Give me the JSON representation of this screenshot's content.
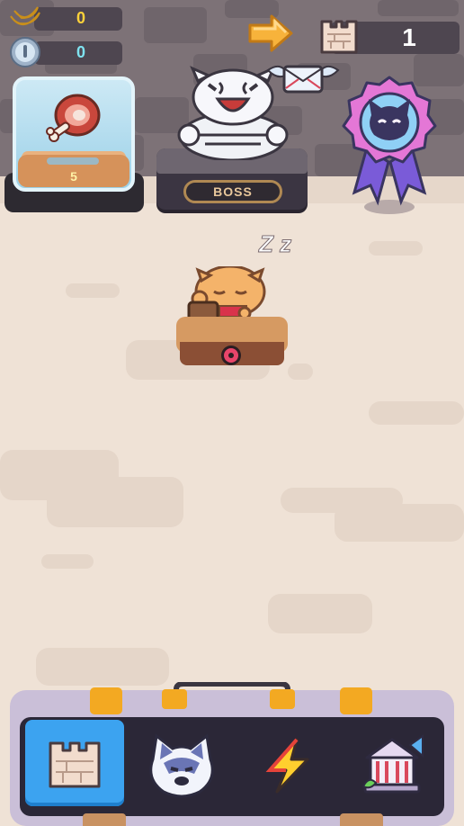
{
  "currencies": {
    "bananas": {
      "value": "0",
      "icon": "banana-icon"
    },
    "coins": {
      "value": "0",
      "icon": "silver-coin-icon"
    }
  },
  "level": {
    "value": "1",
    "icon": "castle-wall-icon"
  },
  "item_card": {
    "count": "5",
    "icon": "meat-leg-icon"
  },
  "boss": {
    "label": "BOSS",
    "icon": "white-tiger-boss-icon"
  },
  "mail": {
    "icon": "winged-mail-icon"
  },
  "badge": {
    "icon": "cat-rosette-badge-icon"
  },
  "next_arrow": {
    "icon": "arrow-right-icon"
  },
  "sleeper": {
    "icon": "sleeping-tiger-cub-icon",
    "sleep_text": "Z z"
  },
  "bottom_nav": {
    "tabs": [
      {
        "id": "castle",
        "icon": "castle-wall-icon",
        "active": true
      },
      {
        "id": "husky",
        "icon": "husky-face-icon",
        "active": false
      },
      {
        "id": "power",
        "icon": "lightning-icon",
        "active": false
      },
      {
        "id": "bank",
        "icon": "bank-building-icon",
        "active": false
      }
    ]
  },
  "colors": {
    "wall": "#7d7277",
    "floor": "#efe2d6",
    "nav_active": "#3ca3f0",
    "banana_text": "#ffd23a",
    "coin_text": "#7fe3f0"
  }
}
